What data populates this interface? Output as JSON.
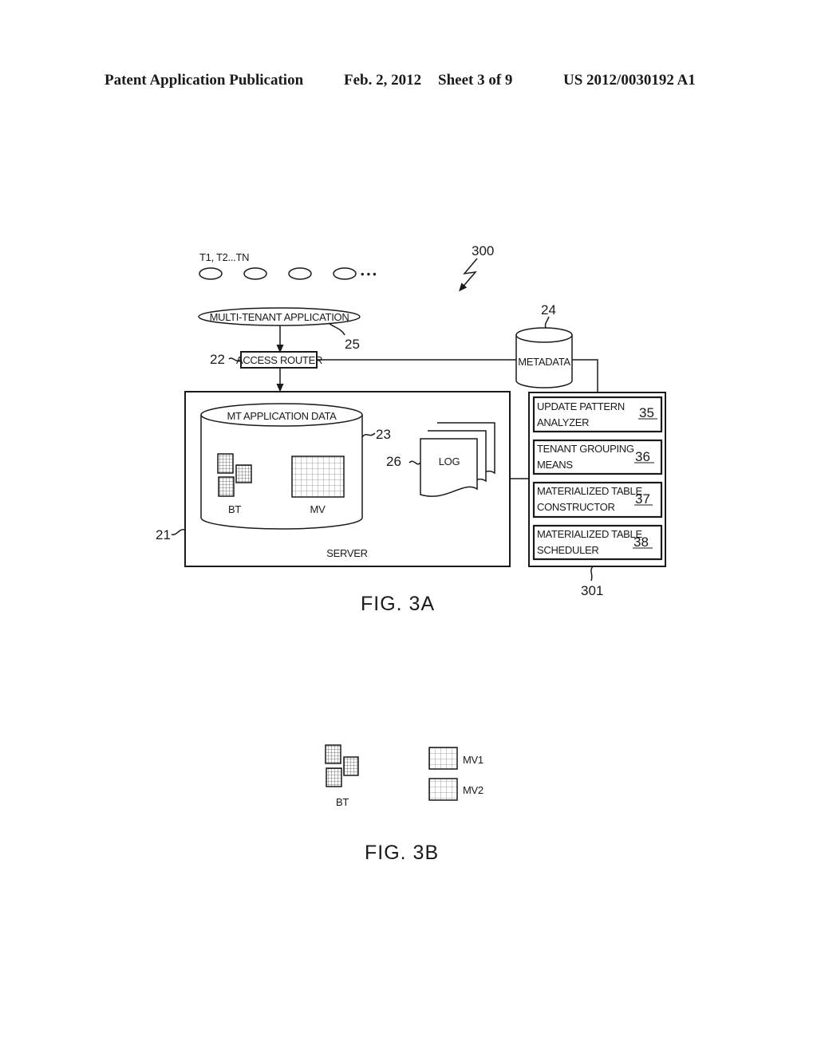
{
  "header": {
    "publication": "Patent Application Publication",
    "date": "Feb. 2, 2012",
    "sheet": "Sheet 3 of 9",
    "number": "US 2012/0030192 A1"
  },
  "fig3a": {
    "caption": "FIG. 3A",
    "system_ref": "300",
    "tenants_label": "T1, T2...TN",
    "tenants_ellipsis": "• • •",
    "app": {
      "label": "MULTI-TENANT APPLICATION",
      "ref": "25"
    },
    "router": {
      "label": "ACCESS ROUTER",
      "ref": "22"
    },
    "metadata": {
      "label": "METADATA",
      "ref": "24"
    },
    "server": {
      "label": "SERVER",
      "ref": "21",
      "database": {
        "label": "MT APPLICATION DATA",
        "ref": "23",
        "bt_label": "BT",
        "mv_label": "MV"
      },
      "log": {
        "label": "LOG",
        "ref": "26"
      }
    },
    "modules": {
      "ref": "301",
      "items": [
        {
          "line1": "UPDATE PATTERN",
          "line2": "ANALYZER",
          "ref": "35"
        },
        {
          "line1": "TENANT GROUPING",
          "line2": "MEANS",
          "ref": "36"
        },
        {
          "line1": "MATERIALIZED TABLE",
          "line2": "CONSTRUCTOR",
          "ref": "37"
        },
        {
          "line1": "MATERIALIZED TABLE",
          "line2": "SCHEDULER",
          "ref": "38"
        }
      ]
    }
  },
  "fig3b": {
    "caption": "FIG. 3B",
    "bt_label": "BT",
    "mv1_label": "MV1",
    "mv2_label": "MV2"
  }
}
